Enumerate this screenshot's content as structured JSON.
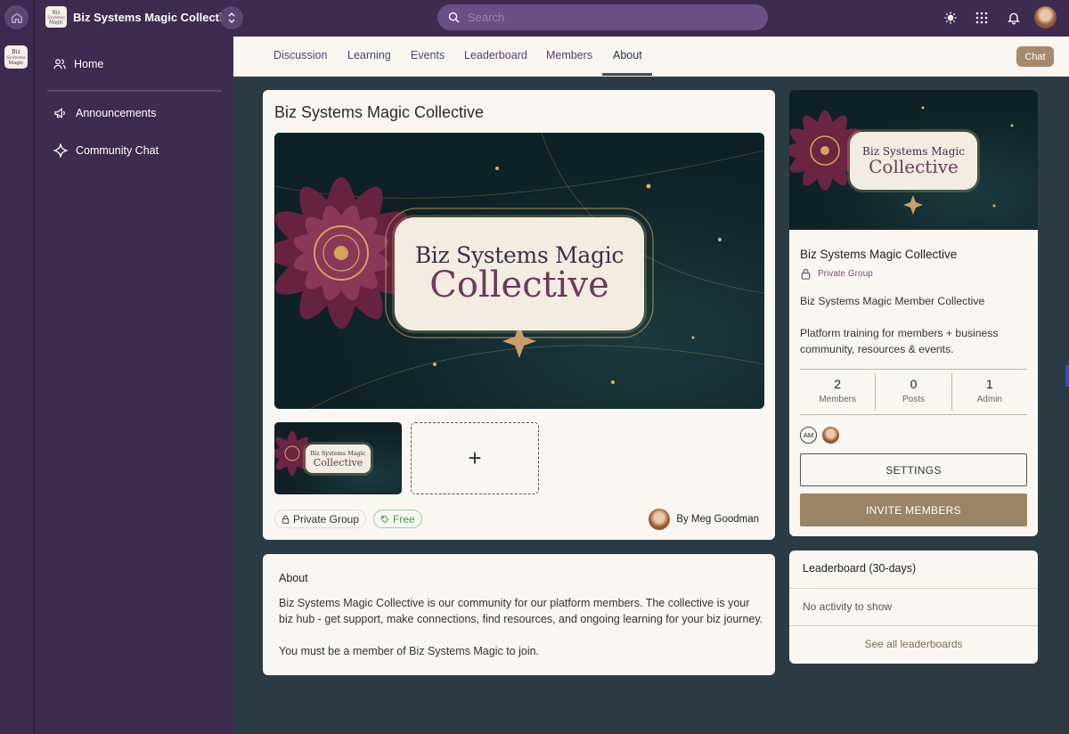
{
  "app": {
    "name": "Biz Systems Magic Collective"
  },
  "logo": {
    "text": "Biz Systems Magic"
  },
  "search": {
    "placeholder": "Search"
  },
  "sidebar": {
    "items": [
      {
        "label": "Home",
        "icon": "people-icon"
      },
      {
        "label": "Announcements",
        "icon": "megaphone-icon"
      },
      {
        "label": "Community Chat",
        "icon": "sparkle-icon"
      }
    ]
  },
  "tabs": [
    {
      "label": "Discussion"
    },
    {
      "label": "Learning"
    },
    {
      "label": "Events"
    },
    {
      "label": "Leaderboard"
    },
    {
      "label": "Members"
    },
    {
      "label": "About",
      "active": true
    }
  ],
  "chat_button": {
    "label": "Chat"
  },
  "main": {
    "title": "Biz Systems Magic Collective",
    "hero": {
      "line1": "Biz Systems Magic",
      "line2": "Collective"
    },
    "add_media": "+",
    "privacy_chip": "Private Group",
    "price_chip": "Free",
    "author": "By Meg Goodman"
  },
  "about": {
    "heading": "About",
    "paragraph1": "Biz Systems Magic Collective is our community for our platform members. The collective is your biz hub - get support, make connections, find resources, and ongoing learning for your biz journey.",
    "paragraph2": "You must be a member of Biz Systems Magic to join."
  },
  "side": {
    "title": "Biz Systems Magic Collective",
    "privacy": "Private Group",
    "tagline": "Biz Systems Magic Member Collective",
    "description": "Platform training for members + business community, resources & events.",
    "stats": [
      {
        "value": "2",
        "label": "Members"
      },
      {
        "value": "0",
        "label": "Posts"
      },
      {
        "value": "1",
        "label": "Admin"
      }
    ],
    "member_initials": "AM",
    "settings_label": "SETTINGS",
    "invite_label": "INVITE MEMBERS"
  },
  "leaderboard": {
    "title": "Leaderboard (30-days)",
    "empty": "No activity to show",
    "link": "See all leaderboards"
  },
  "colors": {
    "sidebar": "#3e2b50",
    "page_bg": "#2b3b43",
    "card": "#faf7f2",
    "accent_button": "#9b8366",
    "chat_button": "#a58a6e",
    "free_green": "#3aa048"
  }
}
